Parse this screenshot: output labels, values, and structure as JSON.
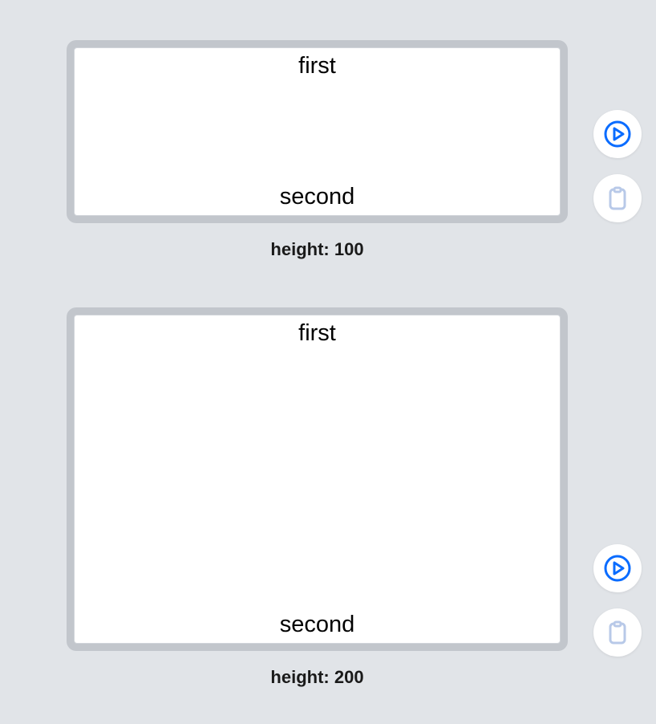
{
  "previews": [
    {
      "top_text": "first",
      "bottom_text": "second",
      "caption": "height: 100",
      "height_value": 100
    },
    {
      "top_text": "first",
      "bottom_text": "second",
      "caption": "height: 200",
      "height_value": 200
    }
  ],
  "icons": {
    "play": "play-icon",
    "copy": "copy-icon"
  },
  "colors": {
    "play_stroke": "#0a6cff",
    "copy_stroke": "#b8c9e8",
    "background": "#e1e4e8",
    "frame": "#c2c6cc"
  }
}
